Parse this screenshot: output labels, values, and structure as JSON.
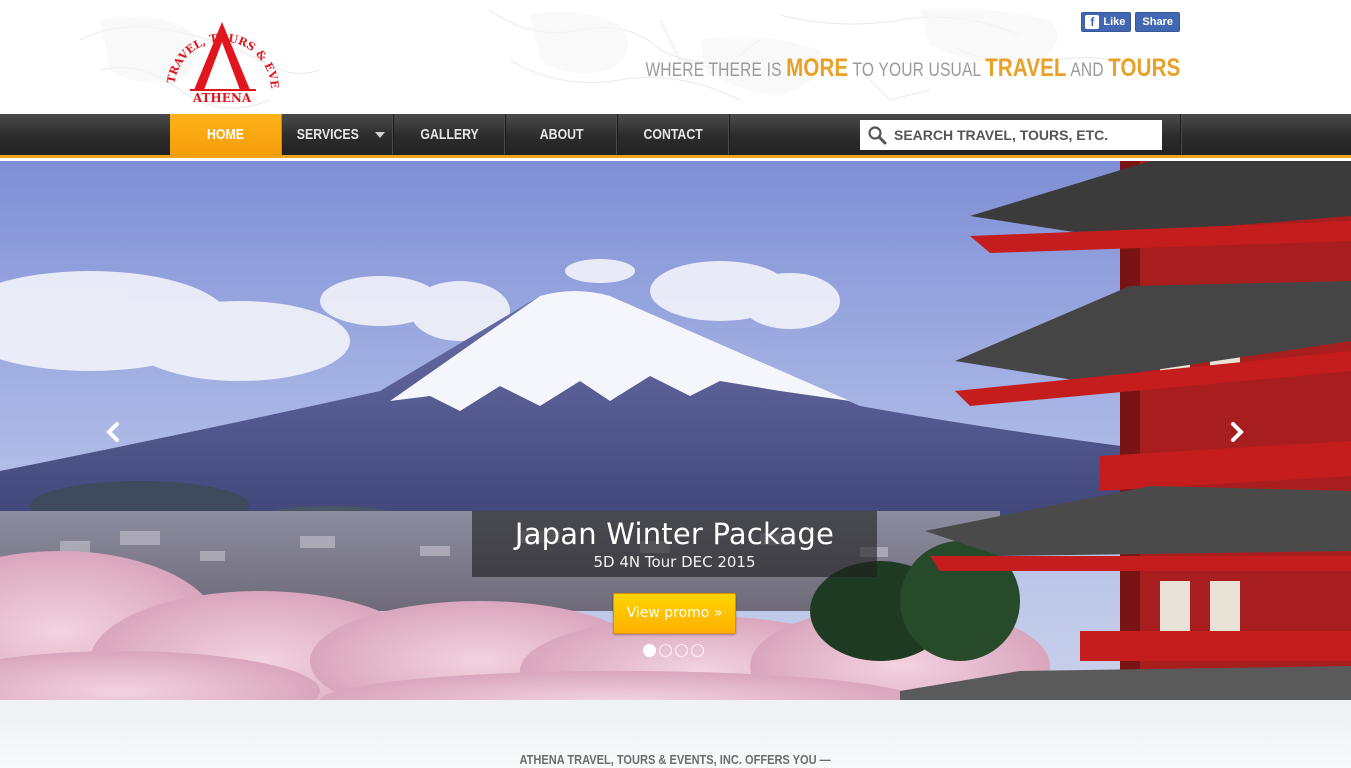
{
  "header": {
    "logo": {
      "arc_text": "TRAVEL, TOURS & EVENTS, INC.",
      "name": "ATHENA",
      "color": "#e0161e"
    },
    "social": {
      "like_label": "Like",
      "share_label": "Share"
    },
    "tagline": {
      "part1": "WHERE THERE IS ",
      "hl1": "MORE",
      "part2": " TO YOUR USUAL ",
      "hl2": "TRAVEL",
      "part3": " AND ",
      "hl3": "TOURS",
      "accent": "#e8a126"
    }
  },
  "nav": {
    "items": [
      {
        "label": "HOME",
        "active": true
      },
      {
        "label": "SERVICES",
        "has_dropdown": true
      },
      {
        "label": "GALLERY"
      },
      {
        "label": "ABOUT"
      },
      {
        "label": "CONTACT"
      }
    ],
    "search_placeholder": "SEARCH TRAVEL, TOURS, ETC.",
    "accent": "#f5a21b"
  },
  "hero": {
    "title": "Japan Winter Package",
    "subtitle": "5D 4N Tour DEC 2015",
    "button_label": "View promo »",
    "slide_count": 4,
    "active_slide": 1,
    "prev_icon": "chevron-left-icon",
    "next_icon": "chevron-right-icon"
  },
  "offers": {
    "text": "ATHENA TRAVEL, TOURS & EVENTS, INC.   OFFERS YOU —"
  }
}
